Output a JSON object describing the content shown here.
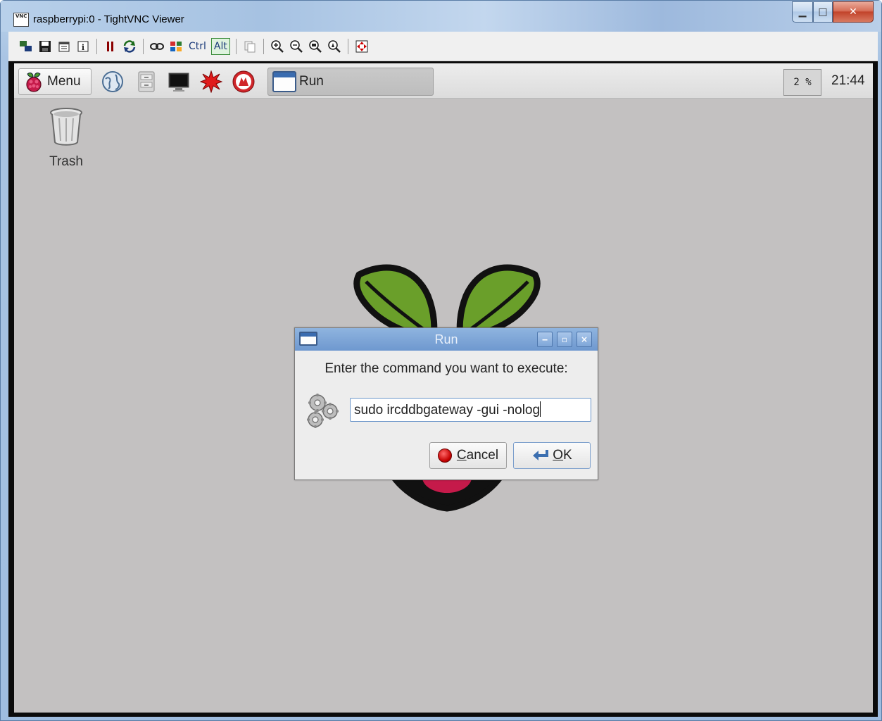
{
  "window": {
    "title": "raspberrypi:0 - TightVNC Viewer",
    "icon_text": "VNC",
    "minimize_glyph": "▁",
    "maximize_glyph": "□",
    "close_glyph": "✕"
  },
  "vnc_toolbar": {
    "ctrl_label": "Ctrl",
    "alt_label": "Alt"
  },
  "panel": {
    "menu_label": "Menu",
    "task_label": "Run",
    "cpu_usage": "2 %",
    "clock": "21:44"
  },
  "desktop": {
    "trash_label": "Trash"
  },
  "run_dialog": {
    "title": "Run",
    "prompt": "Enter the command you want to execute:",
    "command_value": "sudo ircddbgateway -gui -nolog",
    "cancel_label": "Cancel",
    "ok_label": "OK",
    "cancel_mnemonic": "C",
    "ok_mnemonic": "O"
  },
  "colors": {
    "desktop_bg": "#c3c1c1",
    "dialog_title": "#7aa1d4",
    "raspberry_red": "#c51a4a",
    "leaf_green": "#6cb33f"
  }
}
